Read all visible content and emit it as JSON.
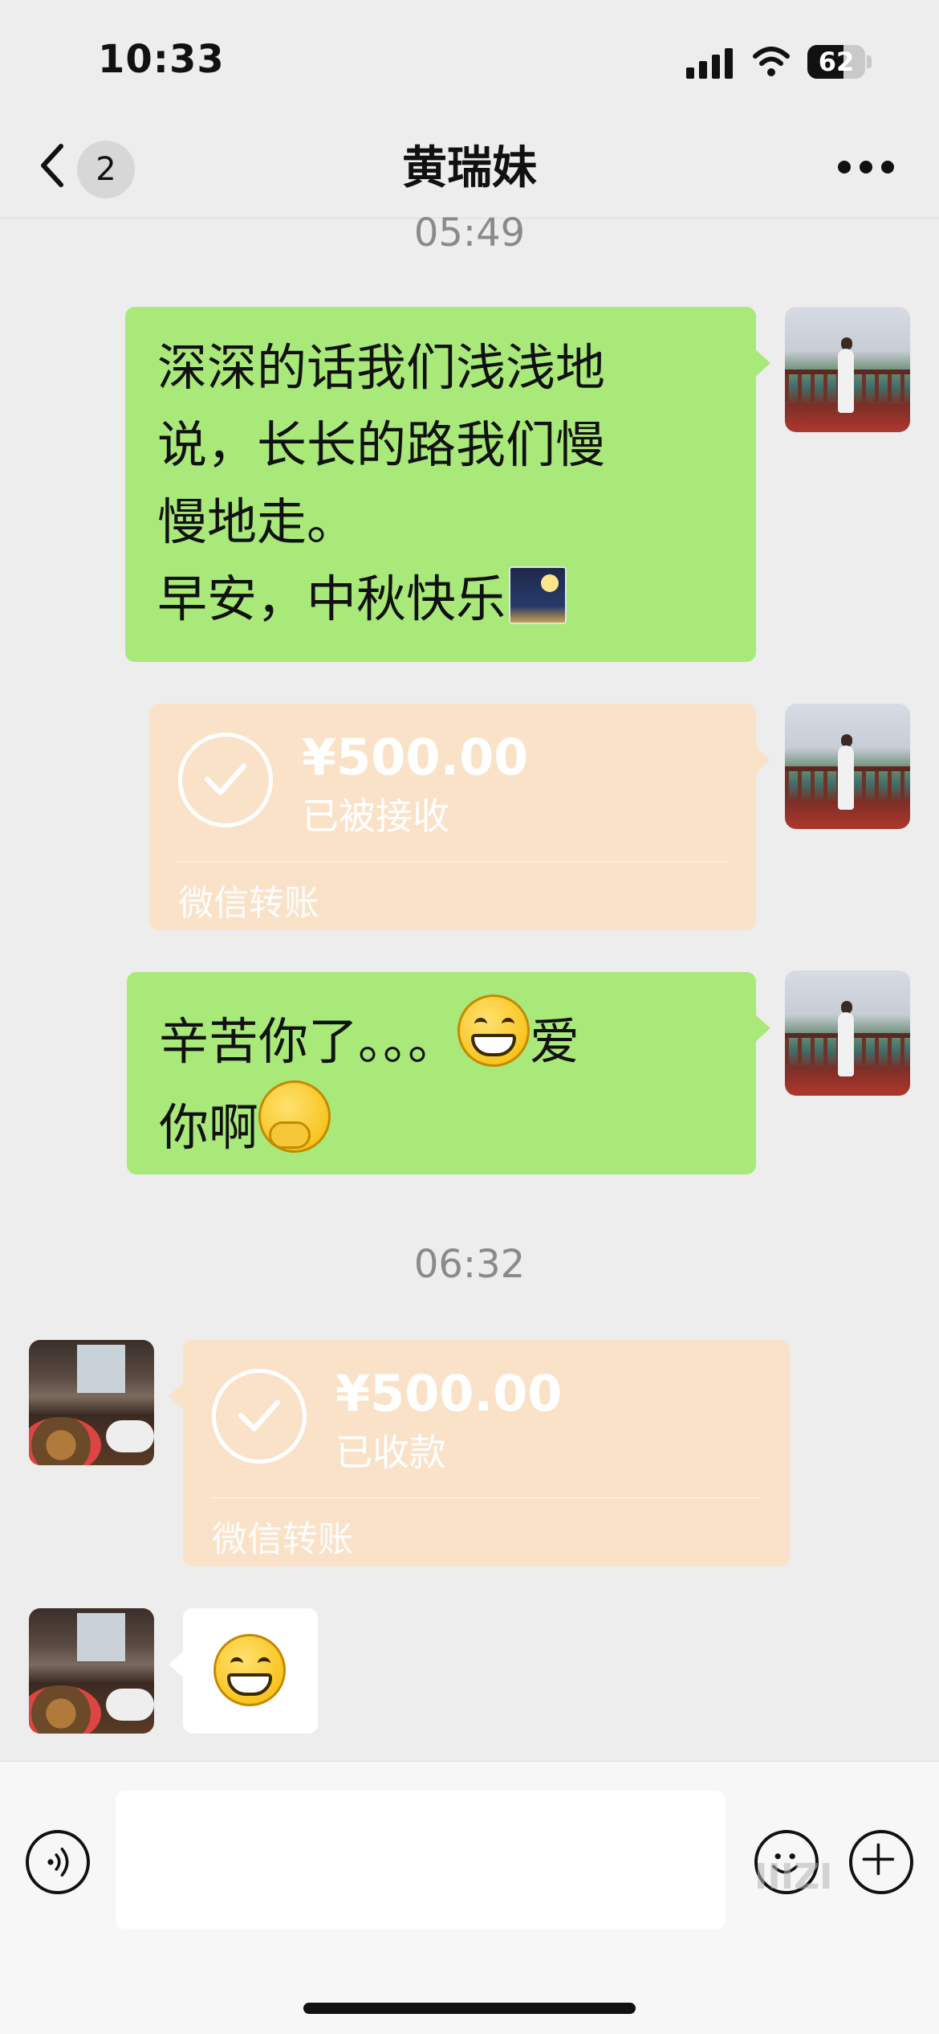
{
  "status_bar": {
    "time": "10:33",
    "battery_level": "62",
    "battery_fraction": 0.62
  },
  "nav": {
    "title": "黄瑞妹",
    "unread_count": "2",
    "back_icon": "chevron-left-icon",
    "more_icon": "more-dots-icon"
  },
  "messages": {
    "timestamp_1": "05:49",
    "msg1_line1": "深深的话我们浅浅地",
    "msg1_line2": "说，长长的路我们慢",
    "msg1_line3": "慢地走。",
    "msg1_line4": "早安，中秋快乐",
    "transfer_sent": {
      "amount": "¥500.00",
      "status": "已被接收",
      "label": "微信转账"
    },
    "msg3_line1_text": "辛苦你了。。。",
    "msg3_line1_after": "爱",
    "msg3_line2": "你啊",
    "timestamp_2": "06:32",
    "transfer_received": {
      "amount": "¥500.00",
      "status": "已收款",
      "label": "微信转账"
    }
  },
  "input_bar": {
    "text_value": "",
    "watermark": "IIIZI"
  },
  "colors": {
    "background": "#ededed",
    "sent_bubble": "#a9e979",
    "transfer_card": "#fae2c8"
  }
}
